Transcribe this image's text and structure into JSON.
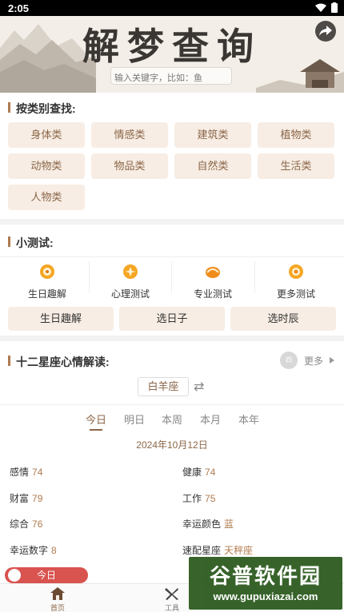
{
  "status": {
    "time": "2:05"
  },
  "header": {
    "title": "解梦查询",
    "search_placeholder": "输入关键字，比如：鱼"
  },
  "category": {
    "title": "按类别查找:",
    "items": [
      "身体类",
      "情感类",
      "建筑类",
      "植物类",
      "动物类",
      "物品类",
      "自然类",
      "生活类",
      "人物类"
    ]
  },
  "quiz": {
    "title": "小测试:",
    "icons": [
      {
        "label": "生日趣解",
        "icon": "birthday-icon"
      },
      {
        "label": "心理测试",
        "icon": "psychology-icon"
      },
      {
        "label": "专业测试",
        "icon": "professional-icon"
      },
      {
        "label": "更多测试",
        "icon": "more-tests-icon"
      }
    ],
    "buttons": [
      "生日趣解",
      "选日子",
      "选时辰"
    ]
  },
  "horoscope": {
    "title": "十二星座心情解读:",
    "more_label": "更多",
    "more_icon_text": "四",
    "sign": "白羊座",
    "tabs": [
      "今日",
      "明日",
      "本周",
      "本月",
      "本年"
    ],
    "active_tab": "今日",
    "date": "2024年10月12日",
    "rows": [
      {
        "label": "感情",
        "value": "74"
      },
      {
        "label": "健康",
        "value": "74"
      },
      {
        "label": "财富",
        "value": "79"
      },
      {
        "label": "工作",
        "value": "75"
      },
      {
        "label": "综合",
        "value": "76"
      },
      {
        "label": "幸运颜色",
        "value": "蓝"
      },
      {
        "label": "幸运数字",
        "value": "8"
      },
      {
        "label": "速配星座",
        "value": "天秤座"
      }
    ],
    "today_pill": "今日"
  },
  "tabbar": [
    {
      "label": "首页",
      "icon": "home-icon"
    },
    {
      "label": "工具",
      "icon": "tools-icon"
    }
  ],
  "watermark": {
    "text": "谷普软件园",
    "url": "www.gupuxiazai.com"
  },
  "colors": {
    "accent": "#8b6648",
    "chip_bg": "#f7ede4",
    "pill": "#d9534f"
  }
}
